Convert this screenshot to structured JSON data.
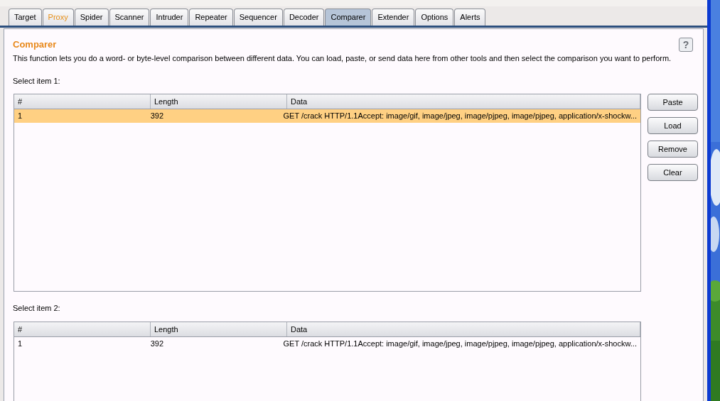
{
  "tabs": [
    {
      "label": "Target",
      "selected": false,
      "highlighted": false
    },
    {
      "label": "Proxy",
      "selected": false,
      "highlighted": true
    },
    {
      "label": "Spider",
      "selected": false,
      "highlighted": false
    },
    {
      "label": "Scanner",
      "selected": false,
      "highlighted": false
    },
    {
      "label": "Intruder",
      "selected": false,
      "highlighted": false
    },
    {
      "label": "Repeater",
      "selected": false,
      "highlighted": false
    },
    {
      "label": "Sequencer",
      "selected": false,
      "highlighted": false
    },
    {
      "label": "Decoder",
      "selected": false,
      "highlighted": false
    },
    {
      "label": "Comparer",
      "selected": true,
      "highlighted": false
    },
    {
      "label": "Extender",
      "selected": false,
      "highlighted": false
    },
    {
      "label": "Options",
      "selected": false,
      "highlighted": false
    },
    {
      "label": "Alerts",
      "selected": false,
      "highlighted": false
    }
  ],
  "panel": {
    "title": "Comparer",
    "help": "?",
    "description": "This function lets you do a word- or byte-level comparison between different data. You can load, paste, or send data here from other tools and then select the comparison you want to perform."
  },
  "lists": [
    {
      "label": "Select item 1:",
      "columns": [
        "#",
        "Length",
        "Data"
      ],
      "rows": [
        {
          "cells": [
            "1",
            "392",
            "GET /crack HTTP/1.1Accept: image/gif, image/jpeg, image/pjpeg, image/pjpeg, application/x-shockw..."
          ],
          "selected": true
        }
      ],
      "buttons": [
        "Paste",
        "Load",
        "Remove",
        "Clear"
      ]
    },
    {
      "label": "Select item 2:",
      "columns": [
        "#",
        "Length",
        "Data"
      ],
      "rows": [
        {
          "cells": [
            "1",
            "392",
            "GET /crack HTTP/1.1Accept: image/gif, image/jpeg, image/pjpeg, image/pjpeg, application/x-shockw..."
          ],
          "selected": false
        }
      ]
    }
  ]
}
